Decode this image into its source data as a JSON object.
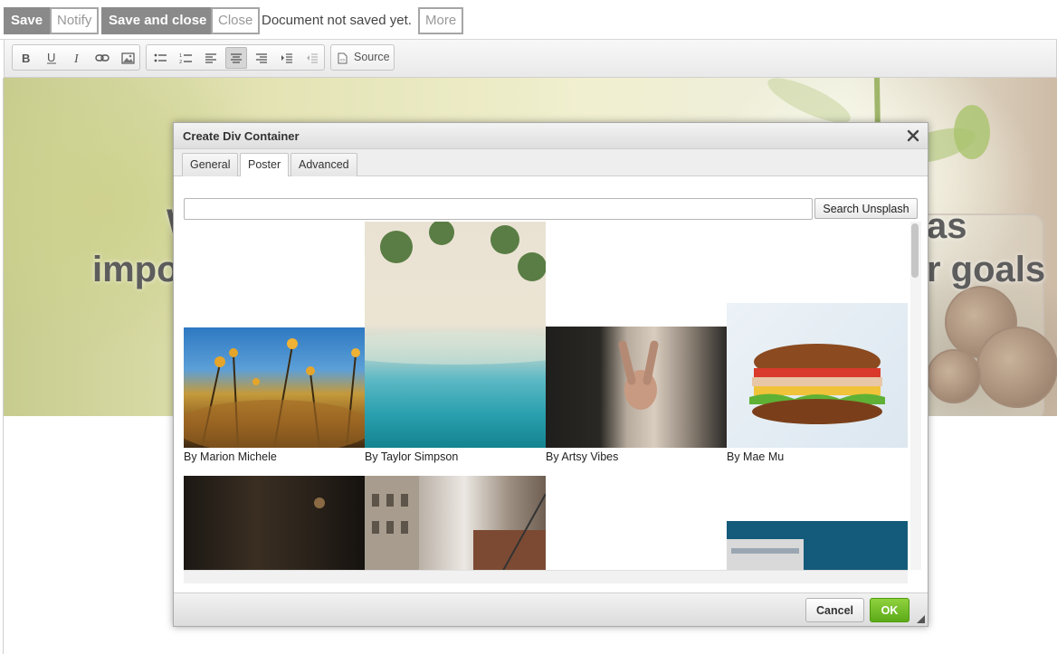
{
  "topbar": {
    "save": "Save",
    "notify": "Notify",
    "save_and_close": "Save and close",
    "close": "Close",
    "status": "Document not saved yet.",
    "more": "More"
  },
  "editor_toolbar": {
    "buttons": [
      "bold-icon",
      "underline-icon",
      "italic-icon",
      "link-icon",
      "image-icon",
      "bulleted-list-icon",
      "numbered-list-icon",
      "align-left-icon",
      "align-center-icon",
      "align-right-icon",
      "indent-icon",
      "outdent-icon"
    ],
    "active": "align-center",
    "source": "Source"
  },
  "hero": {
    "line1_left": "W",
    "line1_right": "as",
    "line2_left": "impo",
    "line2_right": "r goals"
  },
  "dialog": {
    "title": "Create Div Container",
    "tabs": [
      "General",
      "Poster",
      "Advanced"
    ],
    "active_tab": "Poster",
    "search": {
      "value": "",
      "placeholder": "",
      "button": "Search Unsplash"
    },
    "photos": [
      {
        "caption": "By Marion Michele"
      },
      {
        "caption": "By Taylor Simpson"
      },
      {
        "caption": "By Artsy Vibes"
      },
      {
        "caption": "By Mae Mu"
      }
    ],
    "cancel": "Cancel",
    "ok": "OK"
  },
  "colors": {
    "accent_ok": "#6ab521",
    "dark_button": "#8a8a8a"
  }
}
